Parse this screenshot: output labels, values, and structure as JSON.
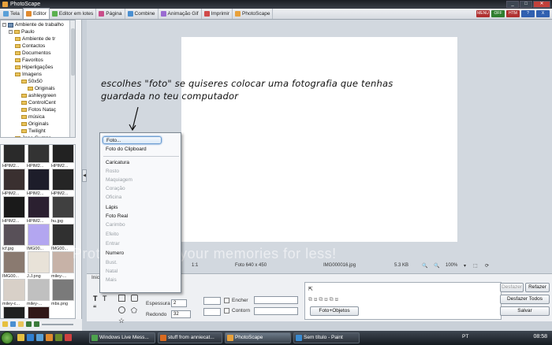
{
  "window": {
    "title": "PhotoScape"
  },
  "tabs": [
    {
      "label": "Tela",
      "color": "#5aa0d8"
    },
    {
      "label": "Editor",
      "color": "#e08a2e"
    },
    {
      "label": "Editor em lotes",
      "color": "#5ab04f"
    },
    {
      "label": "Página",
      "color": "#c94d8a"
    },
    {
      "label": "Combine",
      "color": "#4a8fd1"
    },
    {
      "label": "Animação Gif",
      "color": "#9a6bd1"
    },
    {
      "label": "Imprimir",
      "color": "#d14a4a"
    },
    {
      "label": "PhotoScape",
      "color": "#e8a13b"
    }
  ],
  "active_tab": "Editor",
  "tree": {
    "root": "Ambiente de trabalho",
    "user": "Paulo",
    "items": [
      "Ambiente de tr",
      "Contactos",
      "Documentos",
      "Favoritos",
      "Hiperligações",
      "Imagens",
      "50x50",
      "Originals",
      "ashleygreen",
      "ControlCent",
      "Fotos Nataç",
      "música",
      "Originals",
      "Twilight",
      "Jane Gumps"
    ]
  },
  "thumbnails": [
    {
      "caption": "HPIM2...",
      "color": "#2a2a2a"
    },
    {
      "caption": "HPIM2...",
      "color": "#333333"
    },
    {
      "caption": "HPIM2...",
      "color": "#222222"
    },
    {
      "caption": "HPIM2...",
      "color": "#3a3030"
    },
    {
      "caption": "HPIM2...",
      "color": "#1d1d2a"
    },
    {
      "caption": "HPIM2...",
      "color": "#252525"
    },
    {
      "caption": "HPIM2...",
      "color": "#1a1a1a"
    },
    {
      "caption": "HPIM2...",
      "color": "#2b2030"
    },
    {
      "caption": "hu.jpg",
      "color": "#404040"
    },
    {
      "caption": "icf.jpg",
      "color": "#585058"
    },
    {
      "caption": "IMG00...",
      "color": "#b3a6f0"
    },
    {
      "caption": "IMG00...",
      "color": "#303030"
    },
    {
      "caption": "IMG00...",
      "color": "#8a7a70"
    },
    {
      "caption": "J.J.png",
      "color": "#e8e2d8"
    },
    {
      "caption": "miley-...",
      "color": "#c7b2a7"
    },
    {
      "caption": "miley-c...",
      "color": "#d8d0c8"
    },
    {
      "caption": "miley-...",
      "color": "#c0c0c0"
    },
    {
      "caption": "mbs.png",
      "color": "#7a7a7a"
    },
    {
      "caption": "Sem tit...",
      "color": "#202020"
    },
    {
      "caption": "ste9.jpg",
      "color": "#301818"
    }
  ],
  "annotation": {
    "line1": "escolhes \"foto\" se quiseres colocar uma fotografia que tenhas",
    "line2": "guardada no teu computador"
  },
  "watermark": "Protect more of your memories for less!",
  "menu": {
    "items": [
      {
        "label": "Foto...",
        "enabled": true,
        "highlighted": true
      },
      {
        "label": "Foto do Clipboard",
        "enabled": true
      },
      {
        "label": "Caricatura",
        "enabled": true
      },
      {
        "label": "Rosto",
        "enabled": false
      },
      {
        "label": "Maquiagem",
        "enabled": false
      },
      {
        "label": "Coração",
        "enabled": false
      },
      {
        "label": "Oficina",
        "enabled": false
      },
      {
        "label": "Lápis",
        "enabled": true
      },
      {
        "label": "Foto Real",
        "enabled": true
      },
      {
        "label": "Carimbo",
        "enabled": false
      },
      {
        "label": "Efeito",
        "enabled": false
      },
      {
        "label": "Entrar",
        "enabled": false
      },
      {
        "label": "Numero",
        "enabled": true
      },
      {
        "label": "Bust.",
        "enabled": false
      },
      {
        "label": "Natal",
        "enabled": false
      },
      {
        "label": "Mais",
        "enabled": false
      }
    ]
  },
  "status": {
    "photo_size": "Foto 640 x 450",
    "filename": "IMG000016.jpg",
    "filesize": "5.3 KB",
    "zoom": "100%",
    "ratio": "1:1"
  },
  "panel": {
    "tab_label": "Inic",
    "espessura_label": "Espessura",
    "espessura_value": "2",
    "redondo_label": "Redondo",
    "redondo_value": "32",
    "encher_label": "Encher",
    "contorno_label": "Contorn",
    "objects_button": "Foto+Objetos"
  },
  "actions": {
    "undo": "Desfazer",
    "redo": "Refazer",
    "undo_all": "Desfazer Todos",
    "save": "Salvar"
  },
  "topicons": [
    {
      "label": "MENU",
      "color": "#b03030"
    },
    {
      "label": "OFF",
      "color": "#2f7f2f"
    },
    {
      "label": "HTM",
      "color": "#b03030"
    },
    {
      "label": "?",
      "color": "#3060b0"
    },
    {
      "label": "X",
      "color": "#3060b0"
    }
  ],
  "taskbar": {
    "tasks": [
      {
        "label": "Windows Live Mess...",
        "color": "#4da24d"
      },
      {
        "label": "stuff from anniecat...",
        "color": "#d96a20"
      },
      {
        "label": "PhotoScape",
        "color": "#e8a13b",
        "active": true
      },
      {
        "label": "Sem título - Paint",
        "color": "#3a8ad0"
      }
    ],
    "lang": "PT",
    "clock": "08:58"
  }
}
